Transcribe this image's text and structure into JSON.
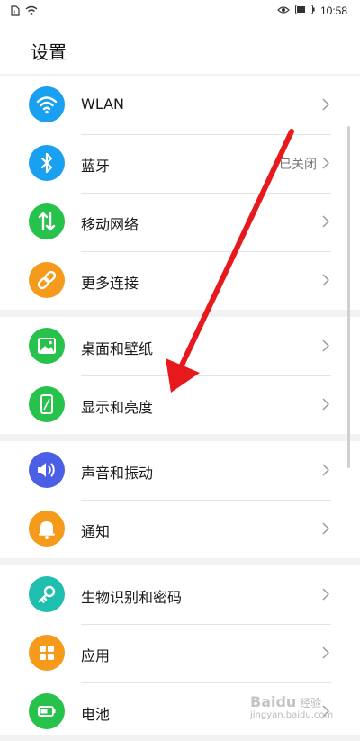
{
  "status_bar": {
    "time": "10:58",
    "icons": [
      "sim-icon",
      "wifi-icon",
      "eye-icon",
      "battery-icon"
    ]
  },
  "page": {
    "title": "设置"
  },
  "groups": [
    {
      "items": [
        {
          "label": "WLAN",
          "value": "",
          "icon": "wifi-icon",
          "color": "#1aa0f0"
        },
        {
          "label": "蓝牙",
          "value": "已关闭",
          "icon": "bluetooth-icon",
          "color": "#1aa0f0"
        },
        {
          "label": "移动网络",
          "value": "",
          "icon": "mobile-data-icon",
          "color": "#27c24c"
        },
        {
          "label": "更多连接",
          "value": "",
          "icon": "link-icon",
          "color": "#f59a1a"
        }
      ]
    },
    {
      "items": [
        {
          "label": "桌面和壁纸",
          "value": "",
          "icon": "wallpaper-icon",
          "color": "#27c24c"
        },
        {
          "label": "显示和亮度",
          "value": "",
          "icon": "display-icon",
          "color": "#27c24c"
        }
      ]
    },
    {
      "items": [
        {
          "label": "声音和振动",
          "value": "",
          "icon": "sound-icon",
          "color": "#4a5fe6"
        },
        {
          "label": "通知",
          "value": "",
          "icon": "bell-icon",
          "color": "#f59a1a"
        }
      ]
    },
    {
      "items": [
        {
          "label": "生物识别和密码",
          "value": "",
          "icon": "key-icon",
          "color": "#1fbfb0"
        },
        {
          "label": "应用",
          "value": "",
          "icon": "apps-icon",
          "color": "#f59a1a"
        },
        {
          "label": "电池",
          "value": "",
          "icon": "battery-setting-icon",
          "color": "#27c24c"
        }
      ]
    }
  ],
  "watermark": {
    "brand": "Baidu",
    "text": "经验",
    "sub": "jingyan.baidu.com"
  },
  "colors": {
    "annotation_arrow": "#e8191c"
  }
}
